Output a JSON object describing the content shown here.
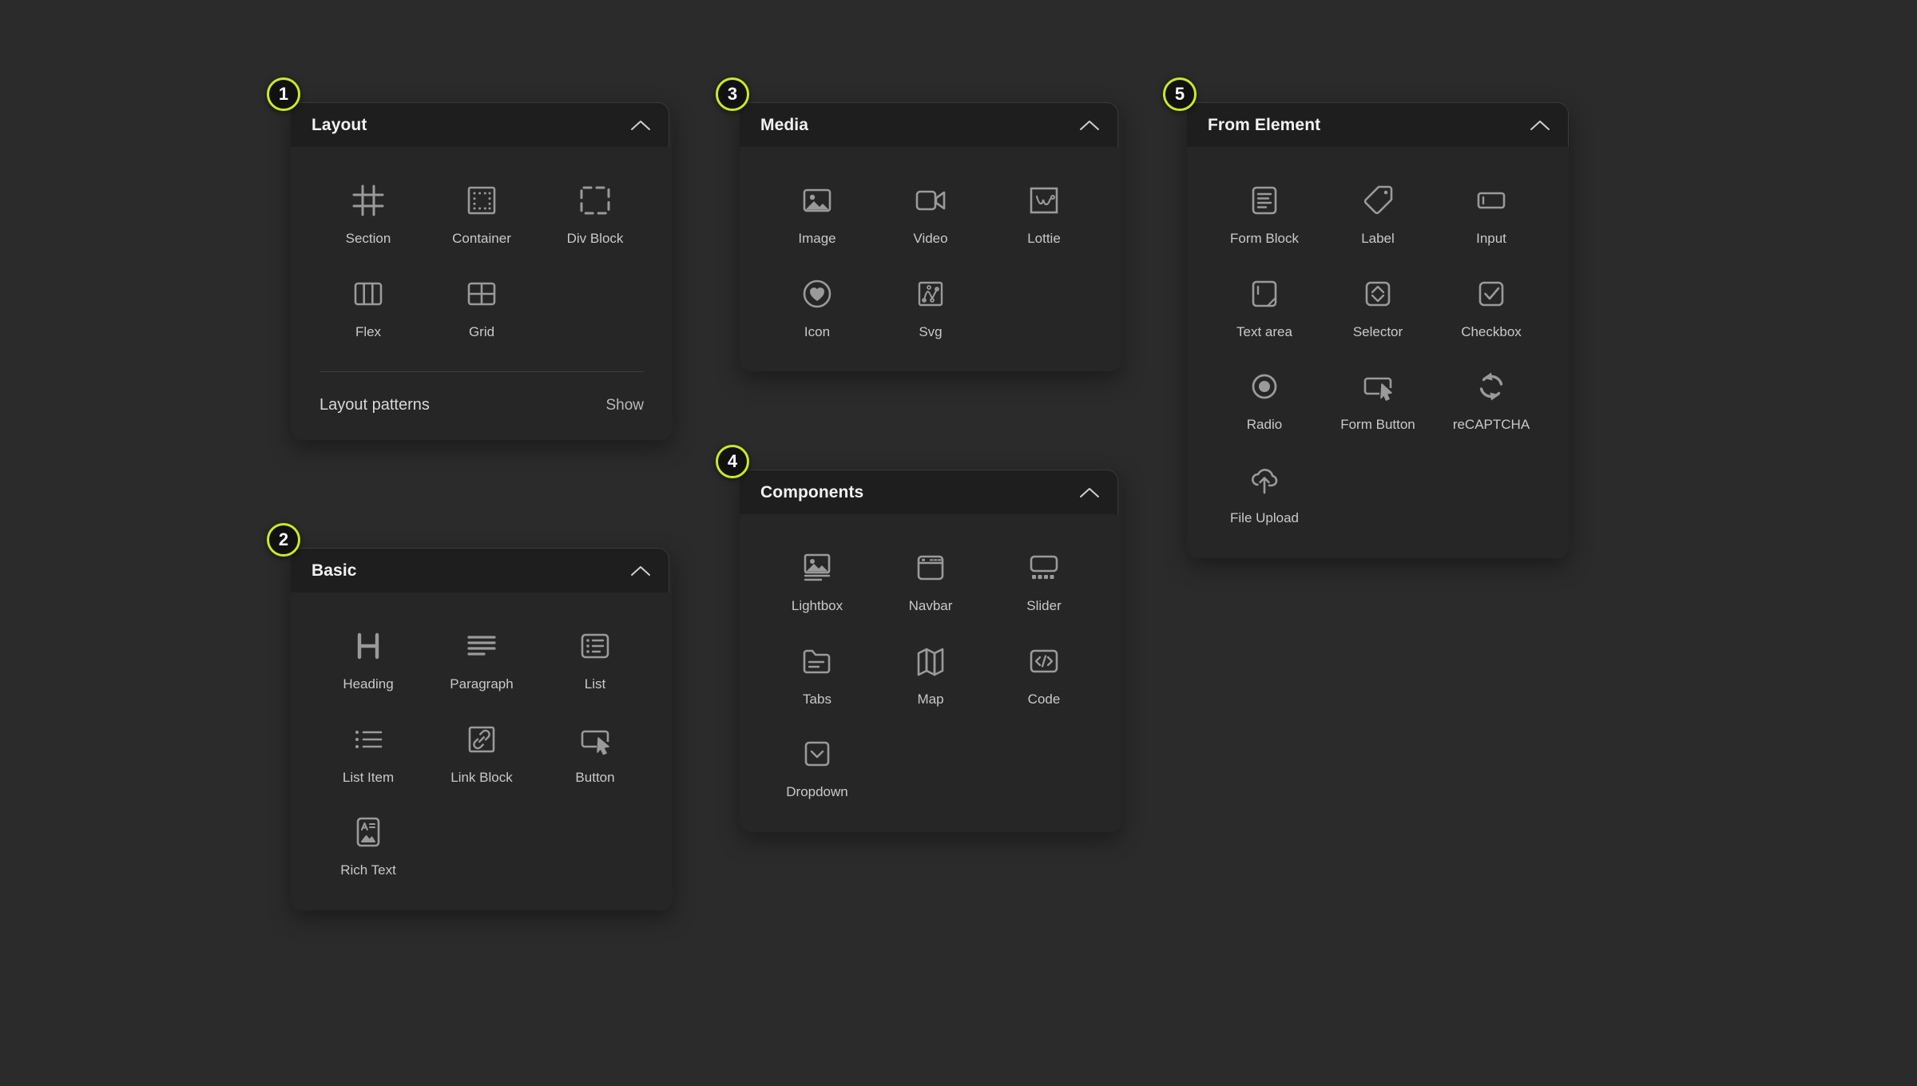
{
  "theme": {
    "background": "#2b2b2b",
    "panel_bg": "#262626",
    "panel_header_bg": "#1e1e1e",
    "accent": "#cbe825",
    "label_color": "#c9c9c9",
    "title_color": "#f2f2f2"
  },
  "panels": [
    {
      "step": "1",
      "title": "Layout",
      "collapse_icon": "chevron-up-icon",
      "items": [
        {
          "label": "Section",
          "icon": "section-grid-icon"
        },
        {
          "label": "Container",
          "icon": "container-dotted-square-icon"
        },
        {
          "label": "Div Block",
          "icon": "div-block-dashed-square-icon"
        },
        {
          "label": "Flex",
          "icon": "flex-columns-icon"
        },
        {
          "label": "Grid",
          "icon": "grid-quadrants-icon"
        }
      ],
      "footer": {
        "label": "Layout patterns",
        "action_label": "Show"
      }
    },
    {
      "step": "2",
      "title": "Basic",
      "collapse_icon": "chevron-up-icon",
      "items": [
        {
          "label": "Heading",
          "icon": "heading-h-icon"
        },
        {
          "label": "Paragraph",
          "icon": "paragraph-lines-icon"
        },
        {
          "label": "List",
          "icon": "list-boxed-icon"
        },
        {
          "label": "List Item",
          "icon": "list-item-bullets-icon"
        },
        {
          "label": "Link Block",
          "icon": "link-chain-icon"
        },
        {
          "label": "Button",
          "icon": "button-cursor-icon"
        },
        {
          "label": "Rich Text",
          "icon": "rich-text-icon"
        }
      ]
    },
    {
      "step": "3",
      "title": "Media",
      "collapse_icon": "chevron-up-icon",
      "items": [
        {
          "label": "Image",
          "icon": "image-picture-icon"
        },
        {
          "label": "Video",
          "icon": "video-camera-icon"
        },
        {
          "label": "Lottie",
          "icon": "lottie-animation-icon"
        },
        {
          "label": "Icon",
          "icon": "heart-circle-icon"
        },
        {
          "label": "Svg",
          "icon": "svg-nodes-icon"
        }
      ]
    },
    {
      "step": "4",
      "title": "Components",
      "collapse_icon": "chevron-up-icon",
      "items": [
        {
          "label": "Lightbox",
          "icon": "lightbox-image-lines-icon"
        },
        {
          "label": "Navbar",
          "icon": "navbar-window-icon"
        },
        {
          "label": "Slider",
          "icon": "slider-dots-icon"
        },
        {
          "label": "Tabs",
          "icon": "tabs-folder-icon"
        },
        {
          "label": "Map",
          "icon": "map-folded-icon"
        },
        {
          "label": "Code",
          "icon": "code-brackets-icon"
        },
        {
          "label": "Dropdown",
          "icon": "dropdown-chevron-box-icon"
        }
      ]
    },
    {
      "step": "5",
      "title": "From Element",
      "collapse_icon": "chevron-up-icon",
      "items": [
        {
          "label": "Form Block",
          "icon": "form-block-document-icon"
        },
        {
          "label": "Label",
          "icon": "label-tag-icon"
        },
        {
          "label": "Input",
          "icon": "input-field-icon"
        },
        {
          "label": "Text area",
          "icon": "textarea-resize-icon"
        },
        {
          "label": "Selector",
          "icon": "selector-diamond-icon"
        },
        {
          "label": "Checkbox",
          "icon": "checkbox-check-icon"
        },
        {
          "label": "Radio",
          "icon": "radio-dot-icon"
        },
        {
          "label": "Form Button",
          "icon": "form-button-cursor-icon"
        },
        {
          "label": "reCAPTCHA",
          "icon": "recaptcha-refresh-icon"
        },
        {
          "label": "File Upload",
          "icon": "file-upload-cloud-icon"
        }
      ]
    }
  ]
}
